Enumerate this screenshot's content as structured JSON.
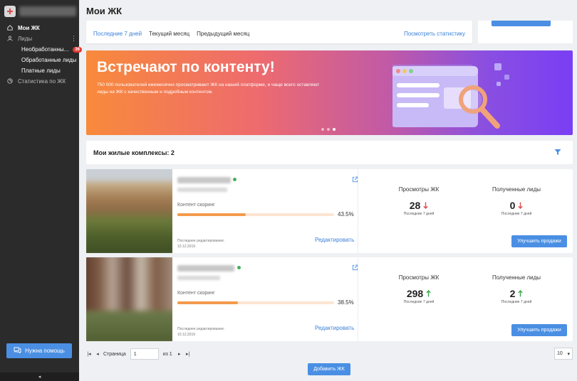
{
  "sidebar": {
    "items": [
      {
        "label": "Мои ЖК",
        "icon": "home-icon"
      },
      {
        "label": "Лиды",
        "icon": "user-icon"
      },
      {
        "label": "Статистика по ЖК",
        "icon": "pie-chart-icon"
      }
    ],
    "sub_items": [
      {
        "label": "Необработанны...",
        "badge": "36"
      },
      {
        "label": "Обработанные лиды"
      },
      {
        "label": "Платные лиды"
      }
    ],
    "help_label": "Нужна помощь",
    "collapse_icon": "◂"
  },
  "header": {
    "title": "Мои ЖК"
  },
  "stats": {
    "tabs": [
      "Последние 7 дней",
      "Текущий месяц",
      "Предыдущий месяц"
    ],
    "selected_tab": 0,
    "link": "Посмотреть статистику"
  },
  "banner": {
    "title": "Встречают по контенту!",
    "text": "750 000 пользователей ежемесячно просматривают ЖК на нашей платформе, и чаще всего оставляют лиды на ЖК с качественным и подробным контентом.",
    "slides": 3,
    "active_slide": 2
  },
  "complexes": {
    "title": "Мои жилые комплексы: 2",
    "items": [
      {
        "scoring_label": "Контент скоринг",
        "scoring_percent": 43.5,
        "scoring_text": "43.5%",
        "edited_label": "Последнее редактирование:",
        "edited_date": "10.12.2019",
        "edit_link": "Редактировать",
        "views_label": "Просмотры ЖК",
        "views": "28",
        "views_trend": "down",
        "leads_label": "Полученные лиды",
        "leads": "0",
        "leads_trend": "down",
        "period": "Последние 7 дней",
        "button": "Улучшить продажи"
      },
      {
        "scoring_label": "Контент скоринг",
        "scoring_percent": 38.5,
        "scoring_text": "38.5%",
        "edited_label": "Последнее редактирование:",
        "edited_date": "10.12.2019",
        "edit_link": "Редактировать",
        "views_label": "Просмотры ЖК",
        "views": "298",
        "views_trend": "up",
        "leads_label": "Полученные лиды",
        "leads": "2",
        "leads_trend": "up",
        "period": "Последние 7 дней",
        "button": "Улучшить продажи"
      }
    ]
  },
  "pager": {
    "page_label": "Страница",
    "page_value": "1",
    "of_label": "из 1",
    "per_page": "10"
  },
  "add_button": "Добавить ЖК",
  "colors": {
    "accent": "#4a8fe3",
    "sidebar_bg": "#2b2b2b",
    "badge": "#e53935",
    "trend_down": "#e24b4b",
    "trend_up": "#3aa84c",
    "scoring_fill": "#f39a4c"
  }
}
